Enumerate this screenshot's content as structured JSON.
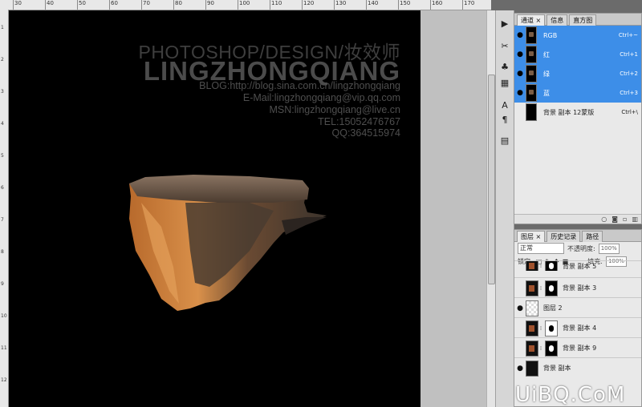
{
  "ruler": {
    "top_labels": [
      "30",
      "40",
      "50",
      "60",
      "70",
      "80",
      "90",
      "100",
      "110",
      "120",
      "130",
      "140",
      "150",
      "160",
      "170"
    ],
    "left_labels": [
      "1",
      "2",
      "3",
      "4",
      "5",
      "6",
      "7",
      "8",
      "9",
      "10",
      "11",
      "12"
    ]
  },
  "canvas_text": {
    "title": "PHOTOSHOP/DESIGN/妆效师",
    "name": "LINGZHONGQIANG",
    "blog": "BLOG:http://blog.sina.com.cn/lingzhongqiang",
    "email": "E-Mail:lingzhongqiang@vip.qq.com",
    "msn": "MSN:lingzhongqiang@live.cn",
    "tel": "TEL:15052476767",
    "qq": "QQ:364515974"
  },
  "tools": [
    "play-icon",
    "crop-icon",
    "stamp-icon",
    "path-icon",
    "type-icon",
    "paragraph-icon",
    "notes-icon"
  ],
  "channels_panel": {
    "tabs": [
      "通道 ×",
      "信息",
      "直方图"
    ],
    "rows": [
      {
        "label": "RGB",
        "shortcut": "Ctrl+~",
        "selected": true,
        "visible": true
      },
      {
        "label": "红",
        "shortcut": "Ctrl+1",
        "selected": true,
        "visible": true
      },
      {
        "label": "绿",
        "shortcut": "Ctrl+2",
        "selected": true,
        "visible": true
      },
      {
        "label": "蓝",
        "shortcut": "Ctrl+3",
        "selected": true,
        "visible": true
      },
      {
        "label": "背景 副本 12蒙版",
        "shortcut": "Ctrl+\\",
        "selected": false,
        "visible": false
      }
    ]
  },
  "layers_panel": {
    "tabs": [
      "图层 ×",
      "历史记录",
      "路径"
    ],
    "blend_mode": "正常",
    "opacity_label": "不透明度:",
    "opacity_value": "100%",
    "lock_label": "锁定:",
    "fill_label": "填充:",
    "fill_value": "100%",
    "layers": [
      {
        "name": "背景 副本 5",
        "visible": false
      },
      {
        "name": "背景 副本 3",
        "visible": false
      },
      {
        "name": "图层 2",
        "visible": true
      },
      {
        "name": "背景 副本 4",
        "visible": false
      },
      {
        "name": "背景 副本 9",
        "visible": false
      },
      {
        "name": "背景 副本",
        "visible": true
      }
    ]
  },
  "watermark": "UiBQ.CoM",
  "colors": {
    "selection": "#3d8ee8",
    "canvas": "#000000",
    "panel": "#e9e9e9"
  }
}
